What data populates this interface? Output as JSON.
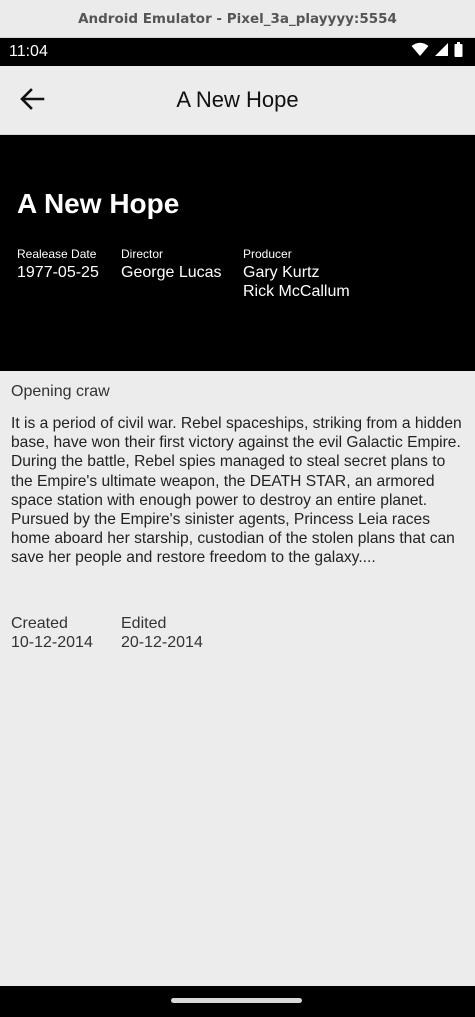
{
  "window": {
    "title": "Android Emulator - Pixel_3a_playyyy:5554"
  },
  "status_bar": {
    "time": "11:04"
  },
  "app_bar": {
    "title": "A New Hope"
  },
  "film": {
    "title": "A New Hope",
    "release_label": "Realease Date",
    "release_date": "1977-05-25",
    "director_label": "Director",
    "director": "George Lucas",
    "producer_label": "Producer",
    "producers": [
      "Gary Kurtz",
      "Rick McCallum"
    ],
    "opening_label": "Opening craw",
    "opening_crawl": "It is a period of civil war. Rebel spaceships, striking from a hidden base, have won their first victory against the evil Galactic Empire.  During the battle, Rebel spies managed to steal secret plans to the Empire's ultimate weapon, the DEATH STAR, an armored space station with enough power to destroy an entire planet.  Pursued by the Empire's sinister agents, Princess Leia races home aboard her starship, custodian of the stolen plans that can save her people and restore freedom to the galaxy....",
    "created_label": "Created",
    "created": "10-12-2014",
    "edited_label": "Edited",
    "edited": "20-12-2014"
  },
  "icons": {
    "back": "arrow-back-icon",
    "wifi": "wifi-icon",
    "signal": "signal-icon",
    "battery": "battery-icon"
  }
}
